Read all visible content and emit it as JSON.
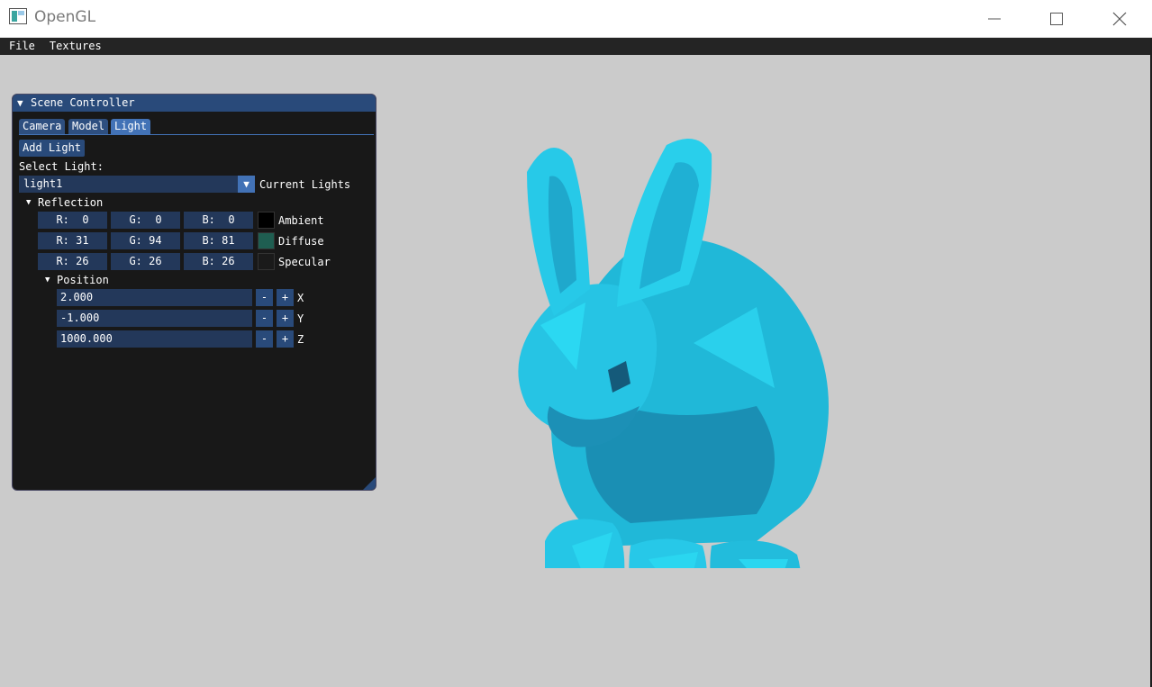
{
  "window": {
    "title": "OpenGL"
  },
  "menu": {
    "items": [
      "File",
      "Textures"
    ]
  },
  "panel": {
    "title": "Scene Controller",
    "tabs": [
      "Camera",
      "Model",
      "Light"
    ],
    "active_tab": "Light",
    "add_light_label": "Add Light",
    "select_light_label": "Select Light:",
    "selected_light": "light1",
    "combo_label": "Current Lights",
    "reflection_label": "Reflection",
    "reflection": [
      {
        "name": "Ambient",
        "r": "R:  0",
        "g": "G:  0",
        "b": "B:  0",
        "color": "#000000"
      },
      {
        "name": "Diffuse",
        "r": "R: 31",
        "g": "G: 94",
        "b": "B: 81",
        "color": "#1f5e51"
      },
      {
        "name": "Specular",
        "r": "R: 26",
        "g": "G: 26",
        "b": "B: 26",
        "color": "#1a1a1a"
      }
    ],
    "position_label": "Position",
    "position": [
      {
        "axis": "X",
        "value": "2.000"
      },
      {
        "axis": "Y",
        "value": "-1.000"
      },
      {
        "axis": "Z",
        "value": "1000.000"
      }
    ],
    "minus_label": "-",
    "plus_label": "+"
  },
  "colors": {
    "model": "#29c8e6",
    "model_shadow": "#1a6f8f",
    "title_bar": "#294a7a",
    "accent": "#4272b6",
    "background": "#cbcbcb"
  }
}
